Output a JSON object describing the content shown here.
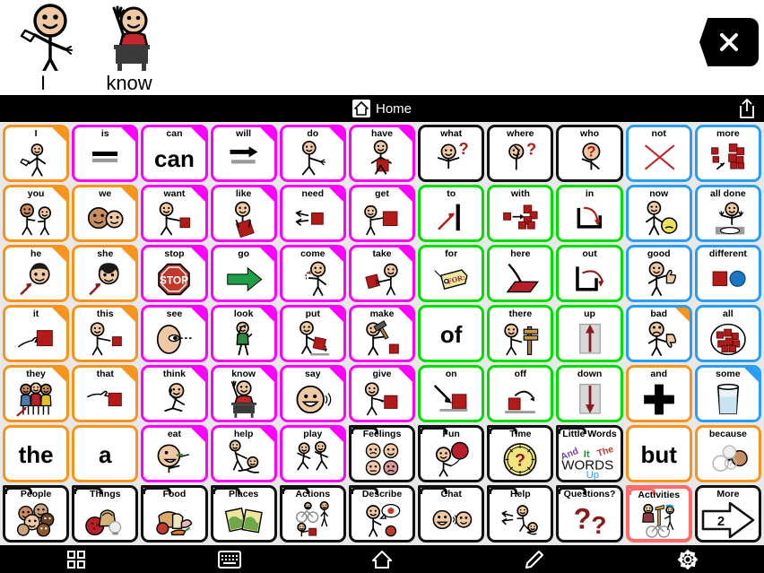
{
  "app": {
    "message_bar": {
      "words": [
        {
          "label": "I",
          "symbol": "person-pointing-self"
        },
        {
          "label": "know",
          "symbol": "person-raising-hand-at-desk"
        }
      ],
      "clear_button": {
        "name": "clear-message-button",
        "icon": "x-icon"
      }
    },
    "toolbar": {
      "home_label": "Home",
      "home_icon": "home-icon",
      "share_icon": "share-icon"
    },
    "bottom_nav": [
      {
        "name": "nav-grid",
        "icon": "grid-icon"
      },
      {
        "name": "nav-keyboard",
        "icon": "keyboard-icon"
      },
      {
        "name": "nav-home",
        "icon": "home-icon"
      },
      {
        "name": "nav-edit",
        "icon": "pencil-icon"
      },
      {
        "name": "nav-settings",
        "icon": "gear-icon"
      }
    ]
  },
  "colors": {
    "orange": "#F7941E",
    "magenta": "#FF00FF",
    "black": "#111111",
    "blue": "#2A9DF4",
    "green": "#00DD00",
    "selected": "#FF6B6B",
    "grid_bg": "#E8E8E8",
    "bar_bg": "#000000"
  },
  "grid": {
    "rows": 7,
    "columns": 11,
    "cells": [
      {
        "label": "I",
        "border": "orange",
        "tab": "orange",
        "symbol": "person-pointing-self",
        "text_only": false
      },
      {
        "label": "is",
        "border": "magenta",
        "tab": "magenta",
        "symbol": "equals-bars",
        "text_only": false
      },
      {
        "label": "can",
        "border": "magenta",
        "tab": "magenta",
        "symbol": "",
        "text_only": true,
        "display_text": "can"
      },
      {
        "label": "will",
        "border": "magenta",
        "tab": "magenta",
        "symbol": "arrow-right-bar",
        "text_only": false
      },
      {
        "label": "do",
        "border": "magenta",
        "tab": "magenta",
        "symbol": "person-doing",
        "text_only": false
      },
      {
        "label": "have",
        "border": "magenta",
        "tab": "magenta",
        "symbol": "person-holding-red-box",
        "text_only": false
      },
      {
        "label": "what",
        "border": "black",
        "tab": "",
        "symbol": "person-question-shrug",
        "text_only": false
      },
      {
        "label": "where",
        "border": "black",
        "tab": "",
        "symbol": "person-looking-question",
        "text_only": false
      },
      {
        "label": "who",
        "border": "black",
        "tab": "",
        "symbol": "person-question-head",
        "text_only": false
      },
      {
        "label": "not",
        "border": "blue",
        "tab": "",
        "symbol": "red-x",
        "text_only": false
      },
      {
        "label": "more",
        "border": "blue",
        "tab": "",
        "symbol": "more-blocks-arrow",
        "text_only": false
      },
      {
        "label": "you",
        "border": "orange",
        "tab": "orange",
        "symbol": "two-people-pointing",
        "text_only": false
      },
      {
        "label": "we",
        "border": "orange",
        "tab": "orange",
        "symbol": "two-faces",
        "text_only": false
      },
      {
        "label": "want",
        "border": "magenta",
        "tab": "magenta",
        "symbol": "person-reaching-box",
        "text_only": false
      },
      {
        "label": "like",
        "border": "magenta",
        "tab": "magenta",
        "symbol": "person-hugging-heart-box",
        "text_only": false
      },
      {
        "label": "need",
        "border": "magenta",
        "tab": "magenta",
        "symbol": "hands-reaching-box",
        "text_only": false
      },
      {
        "label": "get",
        "border": "magenta",
        "tab": "magenta",
        "symbol": "person-grabbing-box",
        "text_only": false
      },
      {
        "label": "to",
        "border": "green",
        "tab": "",
        "symbol": "arrow-to-bar",
        "text_only": false
      },
      {
        "label": "with",
        "border": "green",
        "tab": "",
        "symbol": "blocks-joining",
        "text_only": false
      },
      {
        "label": "in",
        "border": "green",
        "tab": "",
        "symbol": "arrow-into-container",
        "text_only": false
      },
      {
        "label": "now",
        "border": "blue",
        "tab": "",
        "symbol": "person-clock-ball",
        "text_only": false
      },
      {
        "label": "all done",
        "border": "blue",
        "tab": "",
        "symbol": "person-empty-plate",
        "text_only": false
      },
      {
        "label": "he",
        "border": "orange",
        "tab": "orange",
        "symbol": "boy-face-arrow",
        "text_only": false
      },
      {
        "label": "she",
        "border": "orange",
        "tab": "orange",
        "symbol": "girl-face-arrow",
        "text_only": false
      },
      {
        "label": "stop",
        "border": "magenta",
        "tab": "magenta",
        "symbol": "stop-sign",
        "text_only": false
      },
      {
        "label": "go",
        "border": "magenta",
        "tab": "magenta",
        "symbol": "green-arrow",
        "text_only": false
      },
      {
        "label": "come",
        "border": "magenta",
        "tab": "magenta",
        "symbol": "person-beckoning",
        "text_only": false
      },
      {
        "label": "take",
        "border": "magenta",
        "tab": "magenta",
        "symbol": "person-taking-box",
        "text_only": false
      },
      {
        "label": "for",
        "border": "green",
        "tab": "",
        "symbol": "gift-tag",
        "text_only": false
      },
      {
        "label": "here",
        "border": "green",
        "tab": "",
        "symbol": "arrow-down-to-surface",
        "text_only": false
      },
      {
        "label": "out",
        "border": "green",
        "tab": "",
        "symbol": "arrow-out-container",
        "text_only": false
      },
      {
        "label": "good",
        "border": "blue",
        "tab": "",
        "symbol": "person-thumbs-up",
        "text_only": false
      },
      {
        "label": "different",
        "border": "blue",
        "tab": "",
        "symbol": "square-and-circle",
        "text_only": false
      },
      {
        "label": "it",
        "border": "orange",
        "tab": "orange",
        "symbol": "hand-pointing-box",
        "text_only": false
      },
      {
        "label": "this",
        "border": "orange",
        "tab": "orange",
        "symbol": "person-pointing-box",
        "text_only": false
      },
      {
        "label": "see",
        "border": "magenta",
        "tab": "magenta",
        "symbol": "eye-sightline",
        "text_only": false
      },
      {
        "label": "look",
        "border": "magenta",
        "tab": "magenta",
        "symbol": "person-looking",
        "text_only": false
      },
      {
        "label": "put",
        "border": "magenta",
        "tab": "magenta",
        "symbol": "person-placing-box",
        "text_only": false
      },
      {
        "label": "make",
        "border": "magenta",
        "tab": "magenta",
        "symbol": "person-hammering",
        "text_only": false
      },
      {
        "label": "",
        "border": "green",
        "tab": "",
        "symbol": "",
        "text_only": true,
        "display_text": "of"
      },
      {
        "label": "there",
        "border": "green",
        "tab": "",
        "symbol": "person-pointing-signpost",
        "text_only": false
      },
      {
        "label": "up",
        "border": "green",
        "tab": "",
        "symbol": "arrow-up-box",
        "text_only": false
      },
      {
        "label": "bad",
        "border": "blue",
        "tab": "orange",
        "symbol": "person-thumbs-down",
        "text_only": false
      },
      {
        "label": "all",
        "border": "blue",
        "tab": "",
        "symbol": "all-blocks-circled",
        "text_only": false
      },
      {
        "label": "they",
        "border": "orange",
        "tab": "orange",
        "symbol": "group-people-arrow",
        "text_only": false
      },
      {
        "label": "that",
        "border": "orange",
        "tab": "orange",
        "symbol": "hand-pointing-far-box",
        "text_only": false
      },
      {
        "label": "think",
        "border": "magenta",
        "tab": "magenta",
        "symbol": "person-thinking",
        "text_only": false
      },
      {
        "label": "know",
        "border": "magenta",
        "tab": "magenta",
        "symbol": "person-raising-hand-at-desk",
        "text_only": false
      },
      {
        "label": "say",
        "border": "magenta",
        "tab": "magenta",
        "symbol": "face-talking",
        "text_only": false
      },
      {
        "label": "give",
        "border": "magenta",
        "tab": "magenta",
        "symbol": "person-giving-box",
        "text_only": false
      },
      {
        "label": "on",
        "border": "green",
        "tab": "",
        "symbol": "arrow-onto-surface",
        "text_only": false
      },
      {
        "label": "off",
        "border": "green",
        "tab": "",
        "symbol": "box-off-surface",
        "text_only": false
      },
      {
        "label": "down",
        "border": "green",
        "tab": "",
        "symbol": "arrow-down-box",
        "text_only": false
      },
      {
        "label": "and",
        "border": "orange",
        "tab": "",
        "symbol": "plus-sign",
        "text_only": false
      },
      {
        "label": "some",
        "border": "blue",
        "tab": "blue",
        "symbol": "glass-partly-full",
        "text_only": false
      },
      {
        "label": "",
        "border": "orange",
        "tab": "",
        "symbol": "",
        "text_only": true,
        "display_text": "the"
      },
      {
        "label": "",
        "border": "orange",
        "tab": "",
        "symbol": "",
        "text_only": true,
        "display_text": "a"
      },
      {
        "label": "eat",
        "border": "magenta",
        "tab": "magenta",
        "symbol": "person-eating",
        "text_only": false
      },
      {
        "label": "help",
        "border": "magenta",
        "tab": "magenta",
        "symbol": "person-helping",
        "text_only": false
      },
      {
        "label": "play",
        "border": "magenta",
        "tab": "magenta",
        "symbol": "two-people-running",
        "text_only": false
      },
      {
        "label": "Feelings",
        "border": "black",
        "tab": "",
        "symbol": "four-faces-feelings",
        "text_only": false,
        "folder": true
      },
      {
        "label": "Fun",
        "border": "black",
        "tab": "",
        "symbol": "person-balloon",
        "text_only": false,
        "folder": true
      },
      {
        "label": "Time",
        "border": "black",
        "tab": "",
        "symbol": "clock-question",
        "text_only": false,
        "folder": true
      },
      {
        "label": "Little Words",
        "border": "black",
        "tab": "",
        "symbol": "little-words-collage",
        "text_only": false,
        "folder": true
      },
      {
        "label": "",
        "border": "orange",
        "tab": "",
        "symbol": "",
        "text_only": true,
        "display_text": "but"
      },
      {
        "label": "because",
        "border": "orange",
        "tab": "",
        "symbol": "person-speech-question",
        "text_only": false
      },
      {
        "label": "People",
        "border": "black",
        "tab": "",
        "symbol": "group-faces",
        "text_only": false,
        "folder": true
      },
      {
        "label": "Things",
        "border": "black",
        "tab": "",
        "symbol": "basket-ball-toy",
        "text_only": false,
        "folder": true
      },
      {
        "label": "Food",
        "border": "black",
        "tab": "",
        "symbol": "bread-apple-carrot",
        "text_only": false,
        "folder": true
      },
      {
        "label": "Places",
        "border": "black",
        "tab": "",
        "symbol": "two-maps",
        "text_only": false,
        "folder": true
      },
      {
        "label": "Actions",
        "border": "black",
        "tab": "",
        "symbol": "bike-walk-people",
        "text_only": false,
        "folder": true
      },
      {
        "label": "Describe",
        "border": "black",
        "tab": "",
        "symbol": "person-speech-apple",
        "text_only": false,
        "folder": true
      },
      {
        "label": "Chat",
        "border": "black",
        "tab": "",
        "symbol": "two-faces-talking",
        "text_only": false,
        "folder": true
      },
      {
        "label": "Help",
        "border": "black",
        "tab": "",
        "symbol": "hands-person-helping",
        "text_only": false,
        "folder": true
      },
      {
        "label": "Questions?",
        "border": "black",
        "tab": "",
        "symbol": "two-question-marks",
        "text_only": false,
        "folder": true
      },
      {
        "label": "Activities",
        "border": "selected",
        "tab": "",
        "symbol": "people-activities",
        "text_only": false,
        "folder": true,
        "selected": true
      },
      {
        "label": "More",
        "border": "black",
        "tab": "",
        "symbol": "arrow-right-outline",
        "text_only": false,
        "page_number": "2"
      }
    ]
  },
  "little_words": {
    "and": "And",
    "it": "It",
    "the": "The",
    "words": "WORDS",
    "up": "Up"
  },
  "more_cell": {
    "page_number": "2"
  }
}
